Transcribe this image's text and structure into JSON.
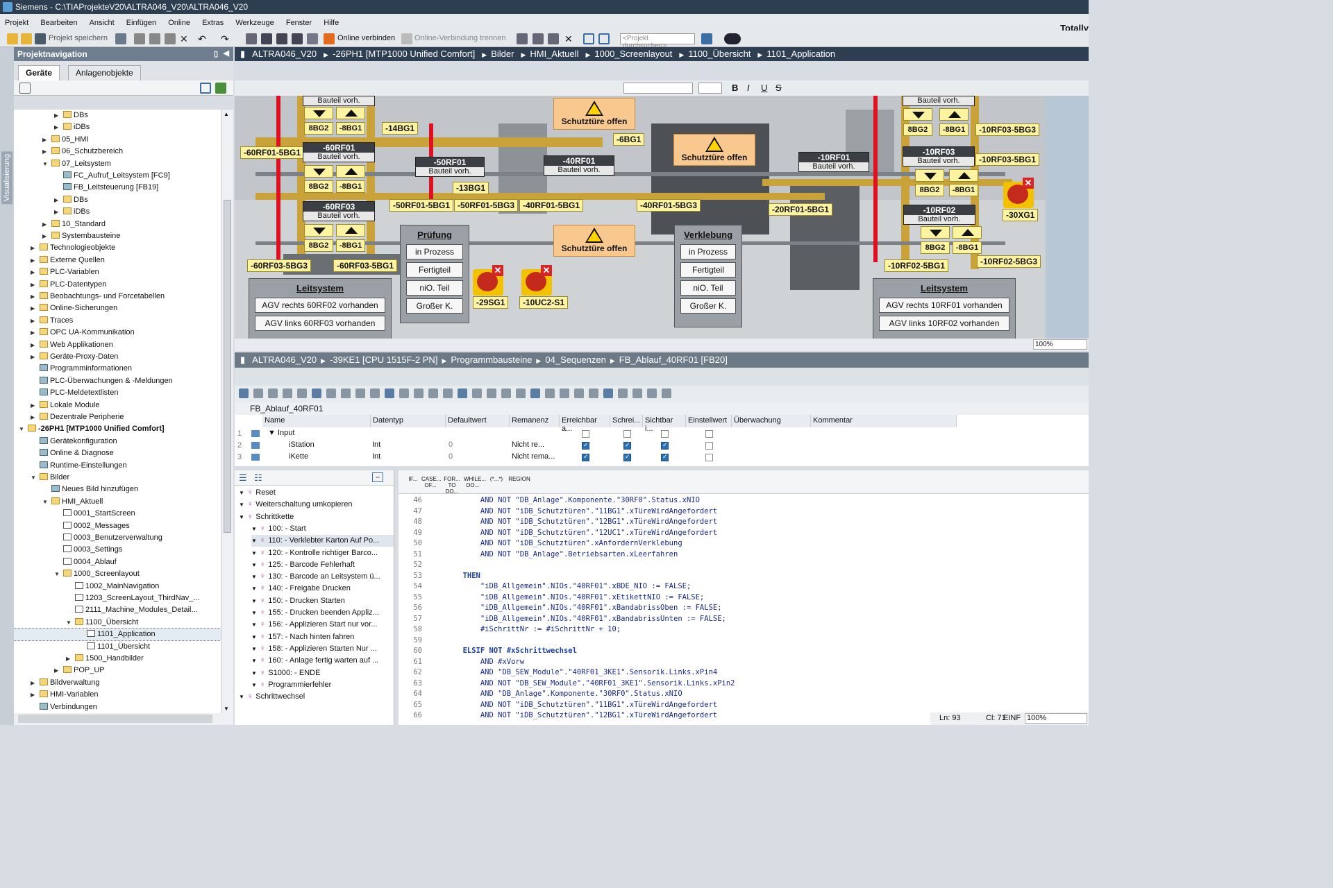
{
  "window": {
    "title": "Siemens - C:\\TIAProjekteV20\\ALTRA046_V20\\ALTRA046_V20",
    "brand_right": "Totally"
  },
  "menu": [
    "Projekt",
    "Bearbeiten",
    "Ansicht",
    "Einfügen",
    "Online",
    "Extras",
    "Werkzeuge",
    "Fenster",
    "Hilfe"
  ],
  "toolbar": {
    "save_label": "Projekt speichern",
    "online_label": "Online verbinden",
    "offline_label": "Online-Verbindung trennen",
    "search_placeholder": "<Projekt durchsuchen>"
  },
  "nav": {
    "header": "Projektnavigation",
    "side_label": "Visualisierung",
    "tabs": [
      "Geräte",
      "Anlagenobjekte"
    ]
  },
  "tree": [
    {
      "label": "DBs",
      "depth": 4,
      "arrow": "▶",
      "icon": "folder"
    },
    {
      "label": "iDBs",
      "depth": 4,
      "arrow": "▶",
      "icon": "folder"
    },
    {
      "label": "05_HMI",
      "depth": 3,
      "arrow": "▶",
      "icon": "folder"
    },
    {
      "label": "06_Schutzbereich",
      "depth": 3,
      "arrow": "▶",
      "icon": "folder"
    },
    {
      "label": "07_Leitsystem",
      "depth": 3,
      "arrow": "▼",
      "icon": "folder"
    },
    {
      "label": "FC_Aufruf_Leitsystem [FC9]",
      "depth": 4,
      "arrow": "",
      "icon": "block"
    },
    {
      "label": "FB_Leitsteuerung [FB19]",
      "depth": 4,
      "arrow": "",
      "icon": "block"
    },
    {
      "label": "DBs",
      "depth": 4,
      "arrow": "▶",
      "icon": "folder"
    },
    {
      "label": "iDBs",
      "depth": 4,
      "arrow": "▶",
      "icon": "folder"
    },
    {
      "label": "10_Standard",
      "depth": 3,
      "arrow": "▶",
      "icon": "folder"
    },
    {
      "label": "Systembausteine",
      "depth": 3,
      "arrow": "▶",
      "icon": "folder"
    },
    {
      "label": "Technologieobjekte",
      "depth": 2,
      "arrow": "▶",
      "icon": "folder"
    },
    {
      "label": "Externe Quellen",
      "depth": 2,
      "arrow": "▶",
      "icon": "folder"
    },
    {
      "label": "PLC-Variablen",
      "depth": 2,
      "arrow": "▶",
      "icon": "folder"
    },
    {
      "label": "PLC-Datentypen",
      "depth": 2,
      "arrow": "▶",
      "icon": "folder"
    },
    {
      "label": "Beobachtungs- und Forcetabellen",
      "depth": 2,
      "arrow": "▶",
      "icon": "folder"
    },
    {
      "label": "Online-Sicherungen",
      "depth": 2,
      "arrow": "▶",
      "icon": "folder"
    },
    {
      "label": "Traces",
      "depth": 2,
      "arrow": "▶",
      "icon": "folder"
    },
    {
      "label": "OPC UA-Kommunikation",
      "depth": 2,
      "arrow": "▶",
      "icon": "folder"
    },
    {
      "label": "Web Applikationen",
      "depth": 2,
      "arrow": "▶",
      "icon": "folder"
    },
    {
      "label": "Geräte-Proxy-Daten",
      "depth": 2,
      "arrow": "▶",
      "icon": "folder"
    },
    {
      "label": "Programminformationen",
      "depth": 2,
      "arrow": "",
      "icon": "block"
    },
    {
      "label": "PLC-Überwachungen & -Meldungen",
      "depth": 2,
      "arrow": "",
      "icon": "block"
    },
    {
      "label": "PLC-Meldetextlisten",
      "depth": 2,
      "arrow": "",
      "icon": "block"
    },
    {
      "label": "Lokale Module",
      "depth": 2,
      "arrow": "▶",
      "icon": "folder"
    },
    {
      "label": "Dezentrale Peripherie",
      "depth": 2,
      "arrow": "▶",
      "icon": "folder"
    },
    {
      "label": "-26PH1 [MTP1000 Unified Comfort]",
      "depth": 1,
      "arrow": "▼",
      "icon": "folder",
      "bold": true
    },
    {
      "label": "Gerätekonfiguration",
      "depth": 2,
      "arrow": "",
      "icon": "block"
    },
    {
      "label": "Online & Diagnose",
      "depth": 2,
      "arrow": "",
      "icon": "block"
    },
    {
      "label": "Runtime-Einstellungen",
      "depth": 2,
      "arrow": "",
      "icon": "block"
    },
    {
      "label": "Bilder",
      "depth": 2,
      "arrow": "▼",
      "icon": "folder"
    },
    {
      "label": "Neues Bild hinzufügen",
      "depth": 3,
      "arrow": "",
      "icon": "block"
    },
    {
      "label": "HMI_Aktuell",
      "depth": 3,
      "arrow": "▼",
      "icon": "folder"
    },
    {
      "label": "0001_StartScreen",
      "depth": 4,
      "arrow": "",
      "icon": "screen"
    },
    {
      "label": "0002_Messages",
      "depth": 4,
      "arrow": "",
      "icon": "screen"
    },
    {
      "label": "0003_Benutzerverwaltung",
      "depth": 4,
      "arrow": "",
      "icon": "screen"
    },
    {
      "label": "0003_Settings",
      "depth": 4,
      "arrow": "",
      "icon": "screen"
    },
    {
      "label": "0004_Ablauf",
      "depth": 4,
      "arrow": "",
      "icon": "screen"
    },
    {
      "label": "1000_Screenlayout",
      "depth": 4,
      "arrow": "▼",
      "icon": "folder"
    },
    {
      "label": "1002_MainNavigation",
      "depth": 5,
      "arrow": "",
      "icon": "screen"
    },
    {
      "label": "1203_ScreenLayout_ThirdNav_...",
      "depth": 5,
      "arrow": "",
      "icon": "screen"
    },
    {
      "label": "2111_Machine_Modules_Detail...",
      "depth": 5,
      "arrow": "",
      "icon": "screen"
    },
    {
      "label": "1100_Übersicht",
      "depth": 5,
      "arrow": "▼",
      "icon": "folder"
    },
    {
      "label": "1101_Application",
      "depth": 6,
      "arrow": "",
      "icon": "screen",
      "selected": true
    },
    {
      "label": "1101_Übersicht",
      "depth": 6,
      "arrow": "",
      "icon": "screen"
    },
    {
      "label": "1500_Handbilder",
      "depth": 5,
      "arrow": "▶",
      "icon": "folder"
    },
    {
      "label": "POP_UP",
      "depth": 4,
      "arrow": "▶",
      "icon": "folder"
    },
    {
      "label": "Bildverwaltung",
      "depth": 2,
      "arrow": "▶",
      "icon": "folder"
    },
    {
      "label": "HMI-Variablen",
      "depth": 2,
      "arrow": "▶",
      "icon": "folder"
    },
    {
      "label": "Verbindungen",
      "depth": 2,
      "arrow": "",
      "icon": "block"
    }
  ],
  "breadcrumb_hmi": [
    "ALTRA046_V20",
    "-26PH1 [MTP1000 Unified Comfort]",
    "Bilder",
    "HMI_Aktuell",
    "1000_Screenlayout",
    "1100_Übersicht",
    "1101_Application"
  ],
  "breadcrumb_plc": [
    "ALTRA046_V20",
    "-39KE1 [CPU 1515F-2 PN]",
    "Programmbausteine",
    "04_Sequenzen",
    "FB_Ablauf_40RF01 [FB20]"
  ],
  "hmi": {
    "zoom": "100%",
    "labels": [
      "-60RF01-5BG1",
      "-14BG1",
      "-6BG1",
      "-13BG1",
      "-50RF01-5BG1",
      "-50RF01-5BG3",
      "-40RF01-5BG1",
      "-40RF01-5BG3",
      "-60RF03-5BG3",
      "-60RF03-5BG1",
      "-29SG1",
      "-10UC2-S1",
      "-20RF01-5BG1",
      "-10RF03-5BG3",
      "-10RF03-5BG1",
      "-30XG1",
      "-10RF02-5BG1",
      "-10RF02-5BG3",
      "8BG2",
      "-8BG1",
      "8BG2",
      "-8BG1",
      "8BG2",
      "-8BG1",
      "8BG2",
      "-8BG1",
      "8BG2",
      "-8BG1",
      "8BG2",
      "-8BG1"
    ],
    "stations": [
      {
        "name": "",
        "sub": "Bauteil vorh."
      },
      {
        "name": "-60RF01",
        "sub": "Bauteil vorh."
      },
      {
        "name": "-60RF03",
        "sub": "Bauteil vorh."
      },
      {
        "name": "-50RF01",
        "sub": "Bauteil vorh."
      },
      {
        "name": "-40RF01",
        "sub": "Bauteil vorh."
      },
      {
        "name": "-10RF01",
        "sub": "Bauteil vorh."
      },
      {
        "name": "",
        "sub": "Bauteil vorh."
      },
      {
        "name": "-10RF03",
        "sub": "Bauteil vorh."
      },
      {
        "name": "-10RF02",
        "sub": "Bauteil vorh."
      }
    ],
    "warning_text": "Schutztüre offen",
    "pruefung": {
      "title": "Prüfung",
      "items": [
        "in Prozess",
        "Fertigteil",
        "niO. Teil",
        "Großer K."
      ]
    },
    "verklebung": {
      "title": "Verklebung",
      "items": [
        "in Prozess",
        "Fertigteil",
        "niO. Teil",
        "Großer K."
      ]
    },
    "leitsystem_left": {
      "title": "Leitsystem",
      "items": [
        "AGV rechts 60RF02 vorhanden",
        "AGV links 60RF03 vorhanden"
      ]
    },
    "leitsystem_right": {
      "title": "Leitsystem",
      "items": [
        "AGV rechts 10RF01 vorhanden",
        "AGV links 10RF02 vorhanden"
      ]
    }
  },
  "fb": {
    "title": "FB_Ablauf_40RF01",
    "columns": [
      "Name",
      "Datentyp",
      "Defaultwert",
      "Remanenz",
      "Erreichbar a...",
      "Schrei...",
      "Sichtbar i...",
      "Einstellwert",
      "Überwachung",
      "Kommentar"
    ],
    "rows": [
      {
        "num": "1",
        "name": "▼ Input",
        "type": "",
        "default": "",
        "rem": ""
      },
      {
        "num": "2",
        "name": "iStation",
        "type": "Int",
        "default": "0",
        "rem": "Nicht re..."
      },
      {
        "num": "3",
        "name": "iKette",
        "type": "Int",
        "default": "0",
        "rem": "Nicht rema..."
      }
    ]
  },
  "outline": [
    {
      "label": "Reset",
      "d": 0
    },
    {
      "label": "Weiterschaltung umkopieren",
      "d": 0
    },
    {
      "label": "Schrittkette",
      "d": 0
    },
    {
      "label": "100: - Start",
      "d": 1
    },
    {
      "label": "110: - Verklebter Karton Auf Po...",
      "d": 1
    },
    {
      "label": "120: - Kontrolle richtiger Barco...",
      "d": 1
    },
    {
      "label": "125: - Barcode Fehlerhaft",
      "d": 1
    },
    {
      "label": "130: - Barcode an Leitsystem ü...",
      "d": 1
    },
    {
      "label": "140: - Freigabe Drucken",
      "d": 1
    },
    {
      "label": "150: - Drucken Starten",
      "d": 1
    },
    {
      "label": "155: - Drucken beenden Appliz...",
      "d": 1
    },
    {
      "label": "156: - Applizieren Start nur vor...",
      "d": 1
    },
    {
      "label": "157: - Nach hinten fahren",
      "d": 1
    },
    {
      "label": "158: - Applizieren Starten Nur ...",
      "d": 1
    },
    {
      "label": "160: - Anlage fertig warten auf ...",
      "d": 1
    },
    {
      "label": "S1000: - ENDE",
      "d": 1
    },
    {
      "label": "Programmierfehler",
      "d": 1
    },
    {
      "label": "Schrittwechsel",
      "d": 0
    }
  ],
  "code_toolbar": [
    "IF...",
    "CASE... OF...",
    "FOR... TO DO...",
    "WHILE... DO...",
    "(*...*)",
    "REGION"
  ],
  "code": [
    {
      "n": "46",
      "t": "            AND NOT \"DB_Anlage\".Komponente.\"30RF0\".Status.xNIO"
    },
    {
      "n": "47",
      "t": "            AND NOT \"iDB_Schutztüren\".\"11BG1\".xTüreWirdAngefordert"
    },
    {
      "n": "48",
      "t": "            AND NOT \"iDB_Schutztüren\".\"12BG1\".xTüreWirdAngefordert"
    },
    {
      "n": "49",
      "t": "            AND NOT \"iDB_Schutztüren\".\"12UC1\".xTüreWirdAngefordert"
    },
    {
      "n": "50",
      "t": "            AND NOT \"iDB_Schutztüren\".xAnfordernVerklebung"
    },
    {
      "n": "51",
      "t": "            AND NOT \"DB_Anlage\".Betriebsarten.xLeerfahren"
    },
    {
      "n": "52",
      "t": ""
    },
    {
      "n": "53",
      "t": "        THEN"
    },
    {
      "n": "54",
      "t": "            \"iDB_Allgemein\".NIOs.\"40RF01\".xBDE_NIO := FALSE;"
    },
    {
      "n": "55",
      "t": "            \"iDB_Allgemein\".NIOs.\"40RF01\".xEtikettNIO := FALSE;"
    },
    {
      "n": "56",
      "t": "            \"iDB_Allgemein\".NIOs.\"40RF01\".xBandabrissOben := FALSE;"
    },
    {
      "n": "57",
      "t": "            \"iDB_Allgemein\".NIOs.\"40RF01\".xBandabrissUnten := FALSE;"
    },
    {
      "n": "58",
      "t": "            #iSchrittNr := #iSchrittNr + 10;"
    },
    {
      "n": "59",
      "t": ""
    },
    {
      "n": "60",
      "t": "        ELSIF NOT #xSchrittwechsel"
    },
    {
      "n": "61",
      "t": "            AND #xVorw"
    },
    {
      "n": "62",
      "t": "            AND \"DB_SEW_Module\".\"40RF01_3KE1\".Sensorik.Links.xPin4"
    },
    {
      "n": "63",
      "t": "            AND NOT \"DB_SEW_Module\".\"40RF01_3KE1\".Sensorik.Links.xPin2"
    },
    {
      "n": "64",
      "t": "            AND \"DB_Anlage\".Komponente.\"30RF0\".Status.xNIO"
    },
    {
      "n": "65",
      "t": "            AND NOT \"iDB_Schutztüren\".\"11BG1\".xTüreWirdAngefordert"
    },
    {
      "n": "66",
      "t": "            AND NOT \"iDB_Schutztüren\".\"12BG1\".xTüreWirdAngefordert"
    }
  ],
  "status": {
    "line": "Ln: 93",
    "col": "Cl: 71",
    "mode": "EINF",
    "zoom": "100%"
  }
}
